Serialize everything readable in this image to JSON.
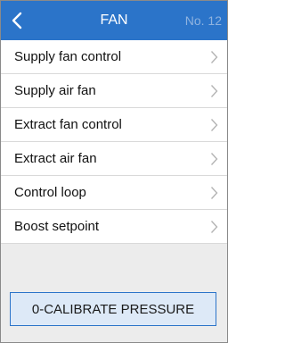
{
  "header": {
    "back_icon": "chevron-left-icon",
    "title": "FAN",
    "page_number": "No. 12"
  },
  "menu": {
    "items": [
      {
        "label": "Supply fan control",
        "icon": "chevron-right-icon"
      },
      {
        "label": "Supply air fan",
        "icon": "chevron-right-icon"
      },
      {
        "label": "Extract fan control",
        "icon": "chevron-right-icon"
      },
      {
        "label": "Extract air fan",
        "icon": "chevron-right-icon"
      },
      {
        "label": "Control loop",
        "icon": "chevron-right-icon"
      },
      {
        "label": "Boost setpoint",
        "icon": "chevron-right-icon"
      }
    ]
  },
  "action": {
    "label": "0-CALIBRATE PRESSURE"
  },
  "colors": {
    "header_bg": "#2b74c9",
    "page_number": "#8fb3df",
    "button_bg": "#dde9f7",
    "button_border": "#2b74c9"
  }
}
